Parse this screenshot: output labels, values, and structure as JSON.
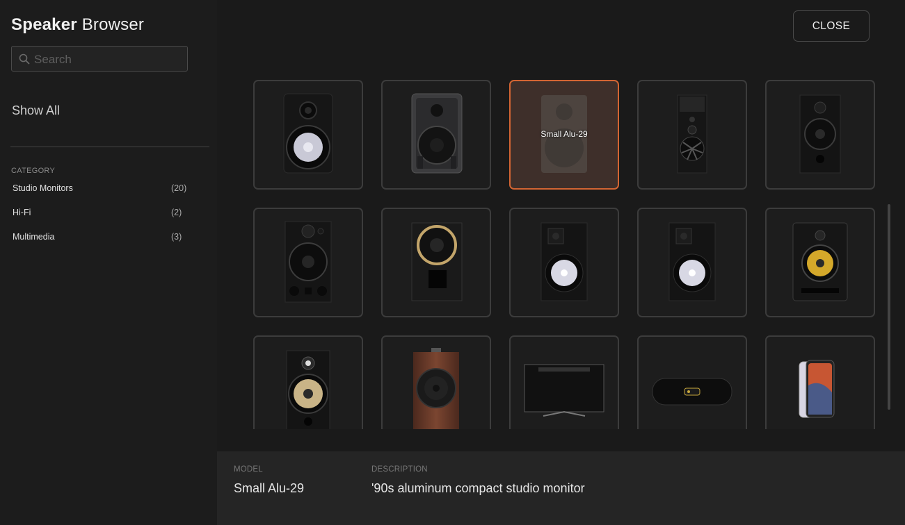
{
  "app": {
    "title_bold": "Speaker",
    "title_rest": "Browser"
  },
  "search": {
    "placeholder": "Search",
    "value": ""
  },
  "sidebar": {
    "show_all_label": "Show All",
    "category_heading": "CATEGORY",
    "categories": [
      {
        "label": "Studio Monitors",
        "count": "(20)"
      },
      {
        "label": "Hi-Fi",
        "count": "(2)"
      },
      {
        "label": "Multimedia",
        "count": "(3)"
      }
    ]
  },
  "toolbar": {
    "close_label": "CLOSE"
  },
  "grid": {
    "selected_label": "Small Alu-29",
    "tiles": [
      {
        "icon": "studio-monitor-white-woofer-icon",
        "selected": false
      },
      {
        "icon": "studio-monitor-dark-grey-icon",
        "selected": false
      },
      {
        "icon": "studio-monitor-aluminum-icon",
        "selected": true,
        "label": "Small Alu-29"
      },
      {
        "icon": "tall-speaker-horn-tweeter-icon",
        "selected": false
      },
      {
        "icon": "tall-black-monitor-icon",
        "selected": false
      },
      {
        "icon": "large-black-monitor-icon",
        "selected": false
      },
      {
        "icon": "gold-ring-monitor-icon",
        "selected": false
      },
      {
        "icon": "monitor-white-woofer-icon",
        "selected": false
      },
      {
        "icon": "monitor-white-woofer-icon",
        "selected": false
      },
      {
        "icon": "yellow-woofer-monitor-icon",
        "selected": false
      },
      {
        "icon": "cream-woofer-monitor-icon",
        "selected": false
      },
      {
        "icon": "wooden-speaker-icon",
        "selected": false
      },
      {
        "icon": "television-icon",
        "selected": false
      },
      {
        "icon": "portable-speaker-icon",
        "selected": false
      },
      {
        "icon": "smartphone-icon",
        "selected": false
      }
    ]
  },
  "details": {
    "model_label": "MODEL",
    "model_value": "Small Alu-29",
    "description_label": "DESCRIPTION",
    "description_value": "'90s aluminum compact studio monitor"
  },
  "colors": {
    "accent": "#d36533",
    "selected_tile_bg": "#3e2f2a",
    "background": "#1a1a1a",
    "panel": "#252525"
  }
}
